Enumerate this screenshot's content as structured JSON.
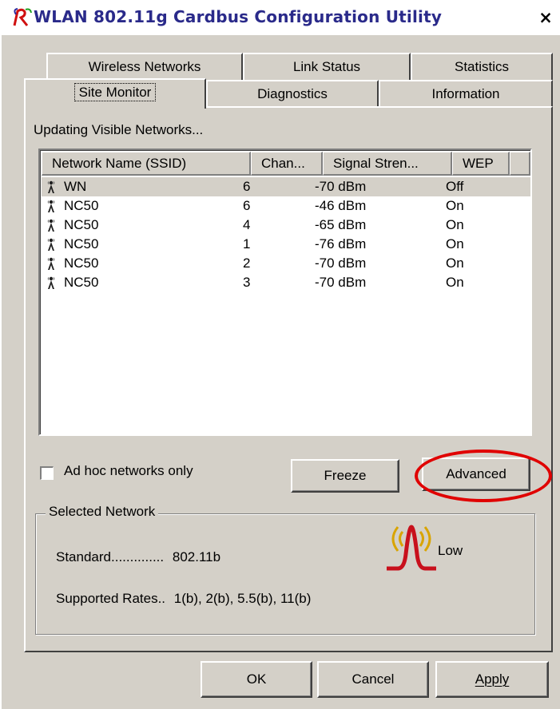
{
  "window": {
    "title": "WLAN 802.11g Cardbus Configuration Utility",
    "close_label": "×"
  },
  "tabs": {
    "top_row": [
      "Wireless Networks",
      "Link Status",
      "Statistics"
    ],
    "bottom_row": [
      "Site Monitor",
      "Diagnostics",
      "Information"
    ],
    "active": "Site Monitor"
  },
  "site_monitor": {
    "status": "Updating Visible Networks...",
    "columns": [
      "Network Name (SSID)",
      "Chan...",
      "Signal Stren...",
      "WEP"
    ],
    "networks": [
      {
        "ssid": "WN",
        "channel": "6",
        "signal": "-70 dBm",
        "wep": "Off",
        "selected": true
      },
      {
        "ssid": "NC50",
        "channel": "6",
        "signal": "-46 dBm",
        "wep": "On",
        "selected": false
      },
      {
        "ssid": "NC50",
        "channel": "4",
        "signal": "-65 dBm",
        "wep": "On",
        "selected": false
      },
      {
        "ssid": "NC50",
        "channel": "1",
        "signal": "-76 dBm",
        "wep": "On",
        "selected": false
      },
      {
        "ssid": "NC50",
        "channel": "2",
        "signal": "-70 dBm",
        "wep": "On",
        "selected": false
      },
      {
        "ssid": "NC50",
        "channel": "3",
        "signal": "-70 dBm",
        "wep": "On",
        "selected": false
      }
    ],
    "adhoc_label": "Ad hoc networks only",
    "adhoc_checked": false,
    "freeze_label": "Freeze",
    "advanced_label": "Advanced"
  },
  "selected_network": {
    "group_label": "Selected Network",
    "standard_label": "Standard..............",
    "standard_value": "802.11b",
    "rates_label": "Supported Rates..",
    "rates_value": "1(b), 2(b), 5.5(b), 11(b)",
    "signal_level": "Low"
  },
  "footer": {
    "ok_label": "OK",
    "cancel_label": "Cancel",
    "apply_label": "Apply"
  },
  "colors": {
    "window_bg": "#d4d0c8",
    "title_text": "#2a2a8a",
    "highlight_ring": "#e00000",
    "signal_icon_red": "#c8101c",
    "signal_icon_gold": "#d9a400"
  }
}
